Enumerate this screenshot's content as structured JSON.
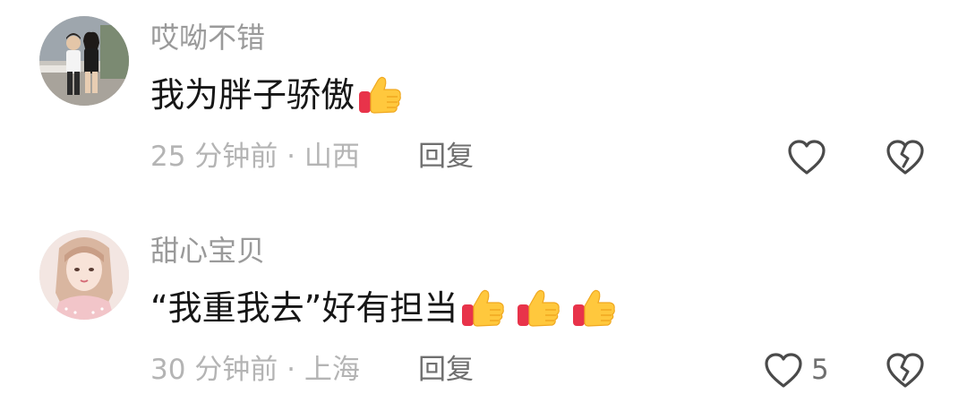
{
  "comments": [
    {
      "username": "哎呦不错",
      "text": "我为胖子骄傲",
      "emojis": [
        "thumbs-up"
      ],
      "time": "25 分钟前 · 山西",
      "reply_label": "回复",
      "like_count": ""
    },
    {
      "username": "甜心宝贝",
      "text": "“我重我去”好有担当",
      "emojis": [
        "thumbs-up",
        "thumbs-up",
        "thumbs-up"
      ],
      "time": "30 分钟前 · 上海",
      "reply_label": "回复",
      "like_count": "5"
    }
  ],
  "icons": {
    "like": "heart-outline-icon",
    "dislike": "broken-heart-outline-icon",
    "emoji": "thumbs-up-emoji"
  },
  "colors": {
    "username": "#9a9a9a",
    "text": "#161616",
    "meta": "#b4b4b4",
    "action": "#6f6f6f",
    "icon_stroke": "#4a4a4a",
    "emoji_yellow": "#ffc83d",
    "emoji_red": "#e8334a"
  }
}
